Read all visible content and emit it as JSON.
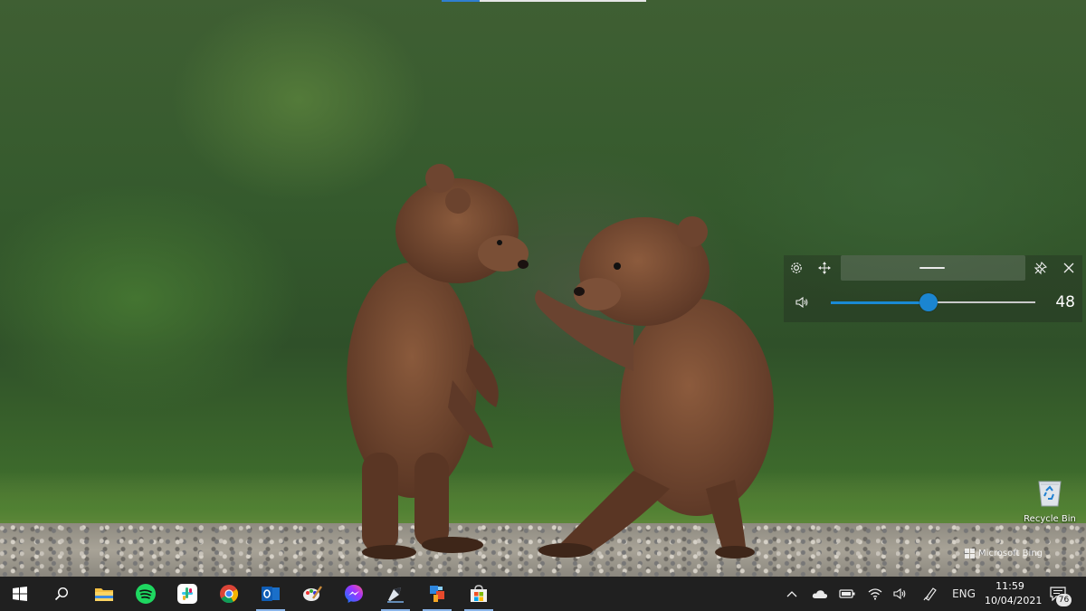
{
  "desktop": {
    "recycle_bin_label": "Recycle Bin",
    "watermark": "Microsoft Bing"
  },
  "volume_flyout": {
    "level": 48,
    "level_label": "48",
    "icons": [
      "settings-icon",
      "move-icon",
      "pin-icon",
      "close-icon",
      "speaker-icon"
    ]
  },
  "taskbar": {
    "apps": [
      {
        "name": "Start",
        "icon": "windows-start-icon"
      },
      {
        "name": "Search",
        "icon": "search-icon"
      },
      {
        "name": "File Explorer",
        "icon": "file-explorer-icon"
      },
      {
        "name": "Spotify",
        "icon": "spotify-icon"
      },
      {
        "name": "Slack",
        "icon": "slack-icon"
      },
      {
        "name": "Chrome",
        "icon": "chrome-icon"
      },
      {
        "name": "Outlook",
        "icon": "outlook-icon"
      },
      {
        "name": "Paint",
        "icon": "paint-icon"
      },
      {
        "name": "Messenger",
        "icon": "messenger-icon"
      },
      {
        "name": "App",
        "icon": "pen-app-icon"
      },
      {
        "name": "App",
        "icon": "pixel-app-icon"
      },
      {
        "name": "Microsoft Store",
        "icon": "store-icon"
      }
    ],
    "tray": {
      "language": "ENG",
      "time": "11:59",
      "date": "10/04/2021",
      "notification_count": "76"
    }
  },
  "colors": {
    "accent": "#1b85d0",
    "taskbar": "#202020"
  }
}
